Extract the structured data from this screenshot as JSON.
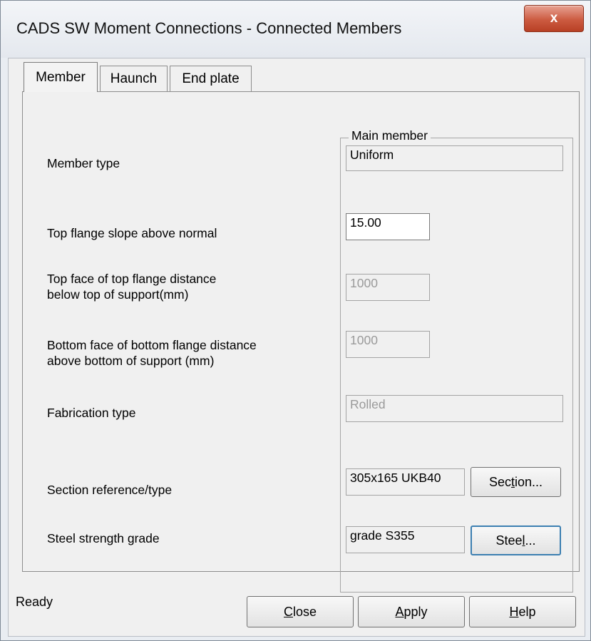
{
  "window": {
    "title": "CADS SW Moment Connections - Connected Members",
    "close_glyph": "x"
  },
  "tabs": [
    {
      "label": "Member",
      "active": true
    },
    {
      "label": "Haunch",
      "active": false
    },
    {
      "label": "End plate",
      "active": false
    }
  ],
  "group": {
    "title": "Main member"
  },
  "rows": {
    "member_type": {
      "label": "Member  type",
      "value": "Uniform"
    },
    "top_flange_slope": {
      "label": "Top flange slope above normal",
      "value": "15.00"
    },
    "top_face": {
      "label_line1": "Top face of top flange distance",
      "label_line2": "below top of support(mm)",
      "value": "1000"
    },
    "bottom_face": {
      "label_line1": "Bottom face of bottom flange distance",
      "label_line2": "above bottom of support (mm)",
      "value": "1000"
    },
    "fabrication": {
      "label": "Fabrication  type",
      "value": "Rolled"
    },
    "section": {
      "label": "Section reference/type",
      "value": "305x165 UKB40",
      "button": {
        "pre": "Sec",
        "accel": "t",
        "post": "ion..."
      }
    },
    "steel": {
      "label": "Steel strength grade",
      "value": "grade S355",
      "button": {
        "pre": "Stee",
        "accel": "l",
        "post": "..."
      }
    }
  },
  "status": "Ready",
  "buttons": {
    "close": {
      "accel": "C",
      "rest": "lose"
    },
    "apply": {
      "accel": "A",
      "rest": "pply"
    },
    "help": {
      "accel": "H",
      "rest": "elp"
    }
  },
  "colors": {
    "close_button": "#cc5b41",
    "focus_border": "#3c7fb1"
  }
}
